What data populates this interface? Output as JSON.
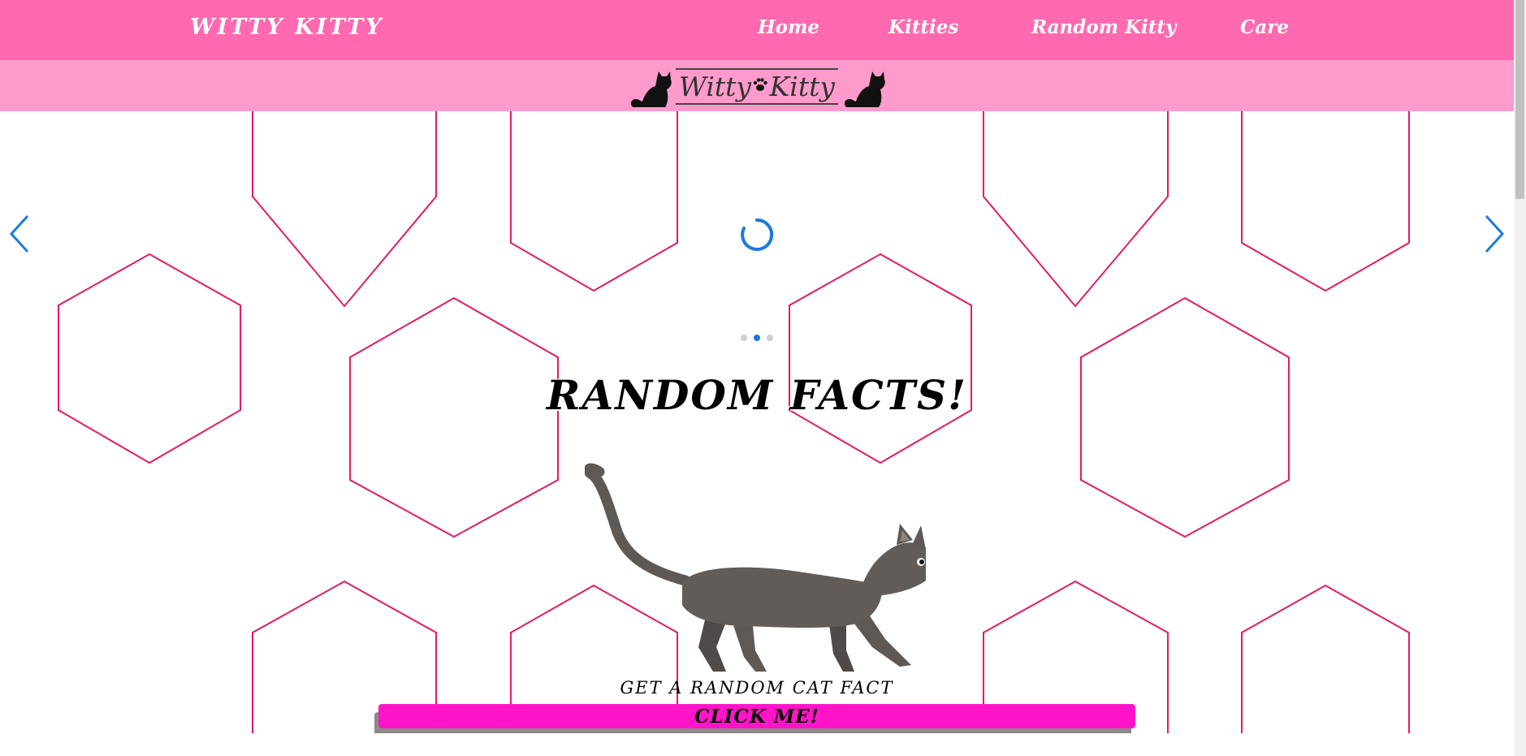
{
  "navbar": {
    "brand": "WITTY KITTY",
    "links": [
      "Home",
      "Kitties",
      "Random Kitty",
      "Care"
    ],
    "background": "#ff69b0"
  },
  "logo": {
    "word1": "Witty",
    "word2": "Kitty",
    "paw_icon": "paw-icon",
    "cat_icon": "cat-silhouette-icon",
    "band_color": "#ff9bcc"
  },
  "carousel": {
    "prev_icon": "chevron-left-icon",
    "next_icon": "chevron-right-icon",
    "loading_icon": "spinner-icon",
    "slide_count": 3,
    "active_slide": 2,
    "accent": "#1a7ae0",
    "hex_color": "#e8195f"
  },
  "main": {
    "heading": "RANDOM FACTS!",
    "image_icon": "walking-cat-illustration",
    "subheading": "GET A RANDOM CAT FACT",
    "button_label": "CLICK ME!",
    "button_color": "#ff14c8"
  }
}
